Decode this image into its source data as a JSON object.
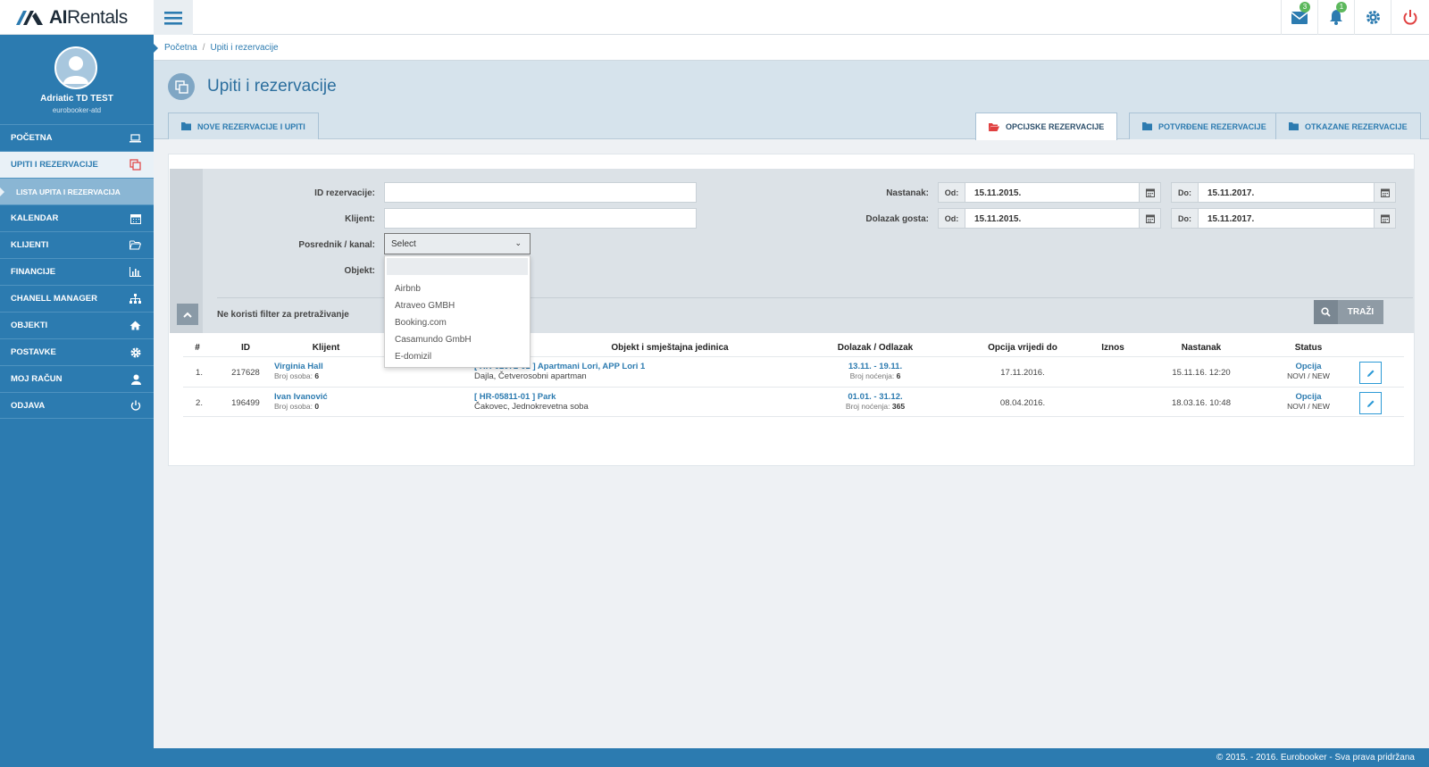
{
  "app": {
    "name_a": "AI",
    "name_b": "Rentals"
  },
  "top": {
    "mail_count": "3",
    "bell_count": "1"
  },
  "user": {
    "name": "Adriatic TD TEST",
    "account": "eurobooker-atd"
  },
  "menu": [
    {
      "label": "POČETNA",
      "icon": "laptop-icon"
    },
    {
      "label": "UPITI I REZERVACIJE",
      "icon": "copy-icon"
    },
    {
      "label": "LISTA UPITA I REZERVACIJA",
      "icon": ""
    },
    {
      "label": "KALENDAR",
      "icon": "calendar-icon"
    },
    {
      "label": "KLIJENTI",
      "icon": "folder-open-icon"
    },
    {
      "label": "FINANCIJE",
      "icon": "bar-chart-icon"
    },
    {
      "label": "CHANELL MANAGER",
      "icon": "sitemap-icon"
    },
    {
      "label": "OBJEKTI",
      "icon": "home-icon"
    },
    {
      "label": "POSTAVKE",
      "icon": "gear-icon"
    },
    {
      "label": "MOJ RAČUN",
      "icon": "user-icon"
    },
    {
      "label": "ODJAVA",
      "icon": "power-icon"
    }
  ],
  "breadcrumb": {
    "home": "Početna",
    "current": "Upiti i rezervacije"
  },
  "page": {
    "title": "Upiti i rezervacije"
  },
  "tabs": [
    "NOVE REZERVACIJE I UPITI",
    "OPCIJSKE REZERVACIJE",
    "POTVRĐENE REZERVACIJE",
    "OTKAZANE REZERVACIJE"
  ],
  "filter": {
    "id_label": "ID rezervacije:",
    "client_label": "Klijent:",
    "channel_label": "Posrednik / kanal:",
    "channel_value": "Select",
    "object_label": "Objekt:",
    "created_label": "Nastanak:",
    "arrival_label": "Dolazak gosta:",
    "from": "Od:",
    "to": "Do:",
    "created_from": "15.11.2015.",
    "created_to": "15.11.2017.",
    "arrival_from": "15.11.2015.",
    "arrival_to": "15.11.2017.",
    "no_filter": "Ne koristi filter za pretraživanje",
    "search": "TRAŽI"
  },
  "dropdown_options": [
    "Airbnb",
    "Atraveo GMBH",
    "Booking.com",
    "Casamundo GmbH",
    "E-domizil"
  ],
  "table": {
    "headers": [
      "#",
      "ID",
      "Klijent",
      "Objekt i smještajna jedinica",
      "Dolazak / Odlazak",
      "Opcija vrijedi do",
      "Iznos",
      "Nastanak",
      "Status"
    ],
    "rows": [
      {
        "num": "1.",
        "id": "217628",
        "client": "Virginia Hall",
        "persons_label": "Broj osoba:",
        "persons": "6",
        "object": "[ HR-02072-01 ] Apartmani Lori, APP Lori 1",
        "object_sub": "Dajla, Četverosobni apartman",
        "dates": "13.11. - 19.11.",
        "nights_label": "Broj noćenja:",
        "nights": "6",
        "option_until": "17.11.2016.",
        "amount": "",
        "created": "15.11.16. 12:20",
        "status": "Opcija",
        "status_sub": "NOVI / NEW"
      },
      {
        "num": "2.",
        "id": "196499",
        "client": "Ivan Ivanović",
        "persons_label": "Broj osoba:",
        "persons": "0",
        "object": "[ HR-05811-01 ] Park",
        "object_sub": "Čakovec, Jednokrevetna soba",
        "dates": "01.01. - 31.12.",
        "nights_label": "Broj noćenja:",
        "nights": "365",
        "option_until": "08.04.2016.",
        "amount": "",
        "created": "18.03.16. 10:48",
        "status": "Opcija",
        "status_sub": "NOVI / NEW"
      }
    ]
  },
  "footer": {
    "copyright": "© 2015. - 2016. Eurobooker - Sva prava pridržana"
  },
  "colors": {
    "primary": "#2c7bb0",
    "sidebar": "#2c7bb0",
    "header_bg": "#d6e3ec",
    "badge": "#5cb85c",
    "power": "#e04040"
  }
}
